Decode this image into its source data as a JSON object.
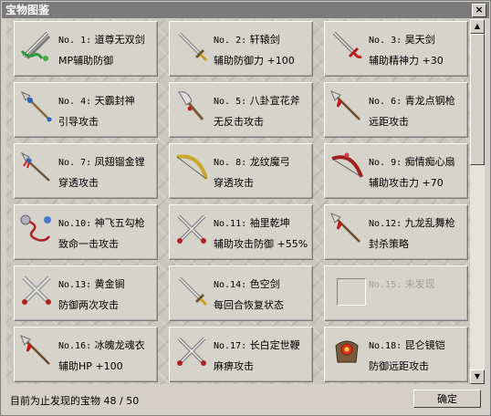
{
  "window": {
    "title": "宝物图鉴",
    "close_label": "×"
  },
  "items": [
    {
      "no": "No. 1:",
      "name": "道尊无双剑",
      "desc": "MP辅助防御",
      "icon": "twin-swords-green-icon"
    },
    {
      "no": "No. 2:",
      "name": "轩辕剑",
      "desc": "辅助防御力 +100",
      "icon": "sword-icon"
    },
    {
      "no": "No. 3:",
      "name": "昊天剑",
      "desc": "辅助精神力 +30",
      "icon": "red-hilt-sword-icon"
    },
    {
      "no": "No. 4:",
      "name": "天霸封神",
      "desc": "引导攻击",
      "icon": "blue-spear-icon"
    },
    {
      "no": "No. 5:",
      "name": "八卦宣花斧",
      "desc": "无反击攻击",
      "icon": "axe-icon"
    },
    {
      "no": "No. 6:",
      "name": "青龙点钢枪",
      "desc": "远距攻击",
      "icon": "spear-icon"
    },
    {
      "no": "No. 7:",
      "name": "凤翅镏金镗",
      "desc": "穿透攻击",
      "icon": "trident-icon"
    },
    {
      "no": "No. 8:",
      "name": "龙纹魔弓",
      "desc": "穿透攻击",
      "icon": "bow-icon"
    },
    {
      "no": "No. 9:",
      "name": "痴情痴心扇",
      "desc": "辅助攻击力 +70",
      "icon": "red-bow-icon"
    },
    {
      "no": "No.10:",
      "name": "神飞五勾枪",
      "desc": "致命一击攻击",
      "icon": "chain-whip-icon"
    },
    {
      "no": "No.11:",
      "name": "袖里乾坤",
      "desc": "辅助攻击防御 +55%",
      "icon": "crossed-swords-icon"
    },
    {
      "no": "No.12:",
      "name": "九龙乱舞枪",
      "desc": "封杀策略",
      "icon": "spear-icon"
    },
    {
      "no": "No.13:",
      "name": "黄金锏",
      "desc": "防御两次攻击",
      "icon": "crossed-maces-icon"
    },
    {
      "no": "No.14:",
      "name": "色空剑",
      "desc": "每回合恢复状态",
      "icon": "sword-icon"
    },
    {
      "no": "No.15:",
      "name": "未发现",
      "desc": "",
      "icon": "empty-slot-icon"
    },
    {
      "no": "No.16:",
      "name": "冰魄龙魂衣",
      "desc": "辅助HP +100",
      "icon": "spear-icon"
    },
    {
      "no": "No.17:",
      "name": "长白定世鞭",
      "desc": "麻痹攻击",
      "icon": "crossed-swords-icon"
    },
    {
      "no": "No.18:",
      "name": "昆仑镜铠",
      "desc": "防御远距攻击",
      "icon": "armor-icon"
    }
  ],
  "footer": {
    "text": "目前为止发现的宝物 48 / 50",
    "ok_label": "确定"
  },
  "scrollbar": {
    "up": "▲",
    "down": "▼"
  }
}
